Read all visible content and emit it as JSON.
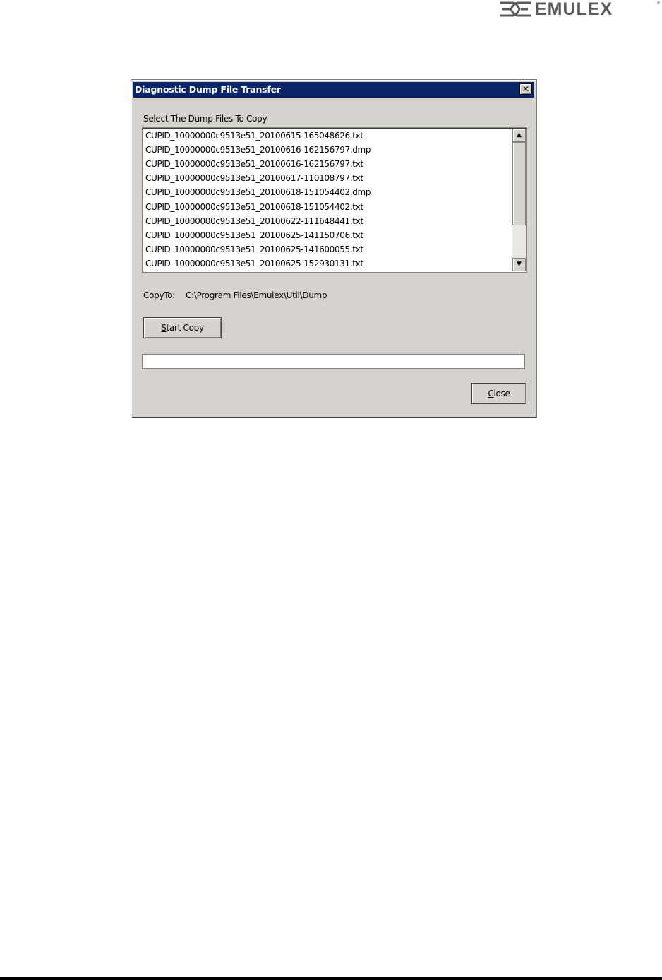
{
  "brand": {
    "name": "EMULEX",
    "registered": "®",
    "accent": "#5a5a5a"
  },
  "dialog": {
    "title": "Diagnostic Dump File Transfer",
    "close_glyph": "✕",
    "select_label": "Select The Dump Files To Copy",
    "files": [
      "CUPID_10000000c9513e51_20100615-165048626.txt",
      "CUPID_10000000c9513e51_20100616-162156797.dmp",
      "CUPID_10000000c9513e51_20100616-162156797.txt",
      "CUPID_10000000c9513e51_20100617-110108797.txt",
      "CUPID_10000000c9513e51_20100618-151054402.dmp",
      "CUPID_10000000c9513e51_20100618-151054402.txt",
      "CUPID_10000000c9513e51_20100622-111648441.txt",
      "CUPID_10000000c9513e51_20100625-141150706.txt",
      "CUPID_10000000c9513e51_20100625-141600055.txt",
      "CUPID_10000000c9513e51_20100625-152930131.txt"
    ],
    "copyto_label": "CopyTo:",
    "copyto_path": "C:\\Program Files\\Emulex\\Util\\Dump",
    "start_copy_mnemonic": "S",
    "start_copy_rest": "tart Copy",
    "close_mnemonic": "C",
    "close_rest": "lose",
    "progress": 0,
    "titlebar_color": "#0a246a",
    "window_color": "#d6d3ce"
  }
}
